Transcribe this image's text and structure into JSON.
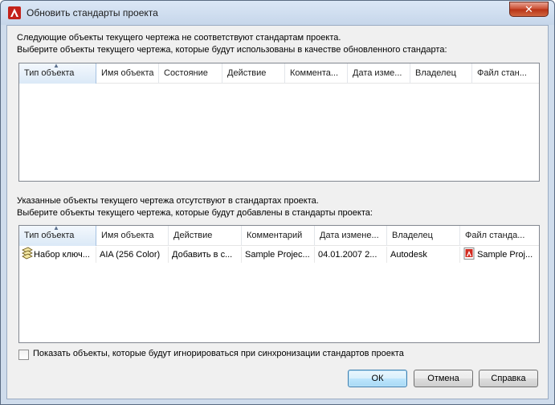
{
  "window": {
    "title": "Обновить стандарты проекта",
    "close_glyph": "✕"
  },
  "top_section": {
    "line1": "Следующие объекты текущего чертежа не соответствуют стандартам проекта.",
    "line2": "Выберите объекты текущего чертежа, которые будут использованы в качестве обновленного стандарта:",
    "columns": [
      "Тип объекта",
      "Имя объекта",
      "Состояние",
      "Действие",
      "Коммента...",
      "Дата изме...",
      "Владелец",
      "Файл стан..."
    ],
    "rows": []
  },
  "bottom_section": {
    "line1": "Указанные объекты текущего чертежа отсутствуют в стандартах проекта.",
    "line2": "Выберите объекты текущего чертежа, которые будут добавлены в стандарты проекта:",
    "columns": [
      "Тип объекта",
      "Имя объекта",
      "Действие",
      "Комментарий",
      "Дата измене...",
      "Владелец",
      "Файл станда..."
    ],
    "rows": [
      {
        "type": "Набор ключ...",
        "type_icon": "layer-key-icon",
        "name": "AIA (256 Color)",
        "action": "Добавить в с...",
        "comment": "Sample Projec...",
        "date": "04.01.2007 2...",
        "owner": "Autodesk",
        "file": "Sample Proj...",
        "file_icon": "autocad-file-icon"
      }
    ]
  },
  "checkbox": {
    "label": "Показать объекты, которые будут игнорироваться при синхронизации стандартов проекта",
    "checked": false
  },
  "buttons": {
    "ok": "ОК",
    "cancel": "Отмена",
    "help": "Справка"
  },
  "colors": {
    "title_bg": "#cfdcec",
    "close_button": "#c8492d",
    "autocad_red": "#d22b20",
    "default_button_border": "#3c7fb1"
  }
}
